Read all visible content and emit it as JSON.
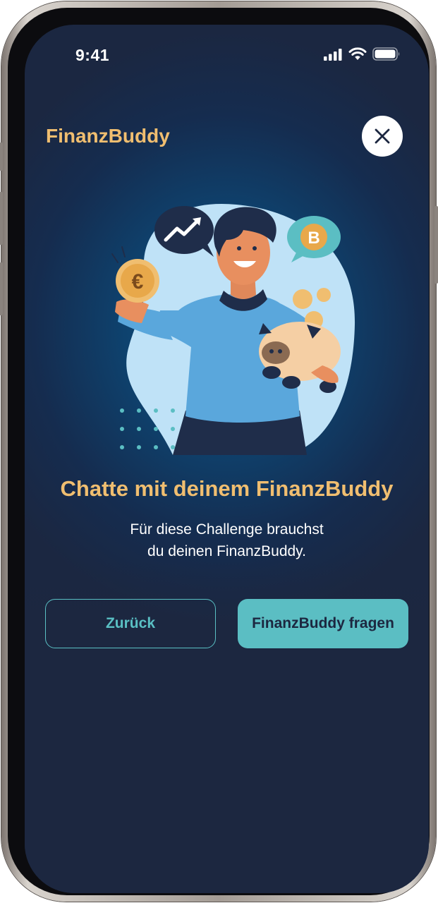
{
  "status_bar": {
    "time": "9:41",
    "icons": [
      "cellular-signal-icon",
      "wifi-icon",
      "battery-icon"
    ]
  },
  "header": {
    "app_title": "FinanzBuddy",
    "close_icon": "close-icon"
  },
  "illustration": {
    "icons": [
      "euro-coin-icon",
      "trend-up-chat-bubble-icon",
      "bitcoin-chat-bubble-icon",
      "piggy-bank-icon"
    ]
  },
  "content": {
    "headline": "Chatte mit deinem FinanzBuddy",
    "subtitle_line1": "Für diese Challenge brauchst",
    "subtitle_line2": "du deinen FinanzBuddy."
  },
  "actions": {
    "back_label": "Zurück",
    "ask_label": "FinanzBuddy fragen"
  },
  "colors": {
    "accent_gold": "#f0be70",
    "accent_teal": "#5bbec3",
    "background_dark": "#1c2740",
    "background_blue": "#0f5a8c"
  }
}
